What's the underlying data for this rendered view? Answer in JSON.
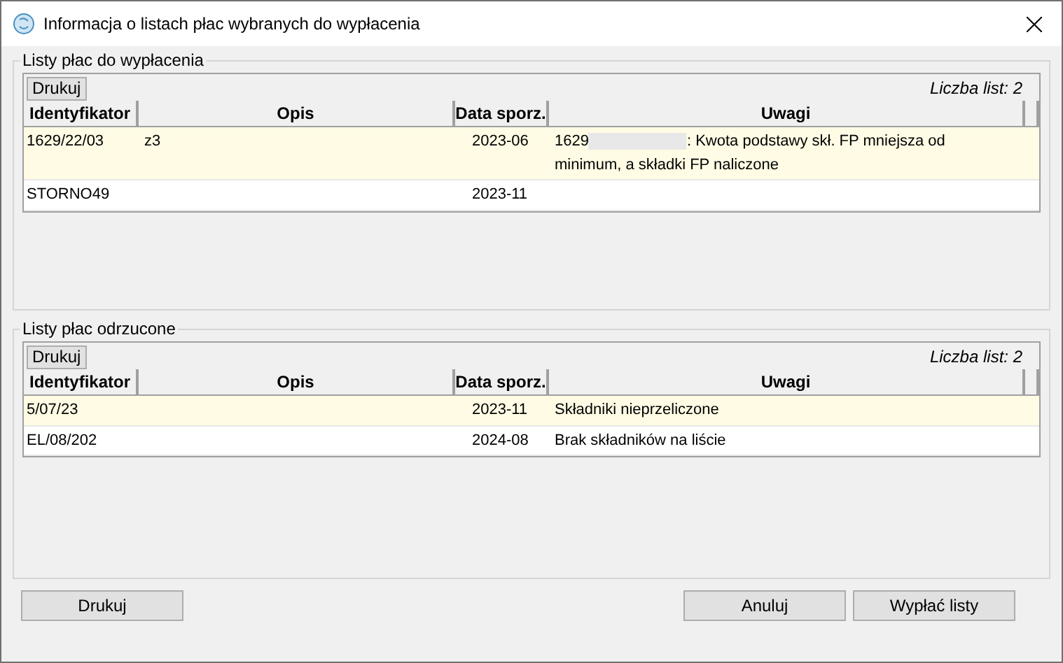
{
  "window": {
    "title": "Informacja o listach płac wybranych do wypłacenia"
  },
  "groups": [
    {
      "title": "Listy płac do wypłacenia",
      "print_button": "Drukuj",
      "count": "Liczba list: 2",
      "columns": [
        "Identyfikator",
        "Opis",
        "Data sporz.",
        "Uwagi"
      ],
      "rows": [
        {
          "selected": true,
          "cells": [
            "1629/22/03",
            "z3",
            "2023-06"
          ],
          "note_parts": [
            "1629",
            ": Kwota podstawy skł. FP mniejsza od minimum, a składki FP naliczone"
          ]
        },
        {
          "selected": false,
          "cells": [
            "STORNO49",
            "",
            "2023-11"
          ],
          "note_parts": []
        }
      ]
    },
    {
      "title": "Listy płac odrzucone",
      "print_button": "Drukuj",
      "count": "Liczba list: 2",
      "columns": [
        "Identyfikator",
        "Opis",
        "Data sporz.",
        "Uwagi"
      ],
      "rows": [
        {
          "selected": true,
          "cells": [
            "5/07/23",
            "",
            "2023-11"
          ],
          "note_parts": [
            "Składniki nieprzeliczone"
          ]
        },
        {
          "selected": false,
          "cells": [
            "EL/08/202",
            "",
            "2024-08"
          ],
          "note_parts": [
            "Brak składników na liście"
          ]
        }
      ]
    }
  ],
  "buttons": {
    "left": "Drukuj",
    "cancel": "Anuluj",
    "confirm": "Wypłać listy"
  }
}
